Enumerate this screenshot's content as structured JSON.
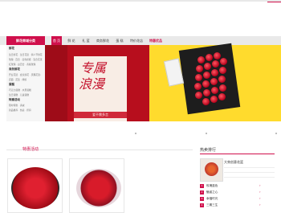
{
  "nav": {
    "category_title": "鲜花商城分类",
    "items": [
      "首 页",
      "鲜 花",
      "礼 篮",
      "商务鲜花",
      "蛋 糕",
      "特价花店",
      "特惠优品"
    ]
  },
  "sidebar": {
    "groups": [
      {
        "title": "鲜花",
        "links": "生日鲜花 · 生日花篮 · 情人节鲜花"
      },
      {
        "title": "",
        "links": "玫瑰 · 百合 · 蓝色妖姬 · 混合花束"
      },
      {
        "title": "",
        "links": "红玫瑰 · 白百合 · 香槟玫瑰"
      },
      {
        "title": "商务鲜花",
        "links": "开业花篮 · 会议鲜花 · 庆典花篮"
      },
      {
        "title": "",
        "links": "店面 · 花篮 · 绿植"
      },
      {
        "title": "蛋糕",
        "links": "巧克力蛋糕 · 水果蛋糕"
      },
      {
        "title": "",
        "links": "生日蛋糕 · 儿童蛋糕"
      },
      {
        "title": "特惠活动",
        "links": "限时特惠 · 满减"
      },
      {
        "title": "",
        "links": "新品推荐 · 热卖 · 折扣"
      }
    ]
  },
  "banner": {
    "poster_line1": "专属",
    "poster_line2": "浪漫",
    "poster_strip": "爱不需多言"
  },
  "sections": {
    "left_title": "特惠活动",
    "right_title": "热卖排行"
  },
  "ranking": {
    "top_title": "大束创意花篮",
    "items": [
      {
        "num": "1",
        "label": "玫瑰蓝色"
      },
      {
        "num": "2",
        "label": "魅惑之心"
      },
      {
        "num": "3",
        "label": "幸福时光"
      },
      {
        "num": "4",
        "label": "三期三生"
      }
    ]
  },
  "colors": {
    "accent": "#d0104c",
    "banner_red": "#b70e1d",
    "banner_yellow": "#ffdb2d"
  }
}
